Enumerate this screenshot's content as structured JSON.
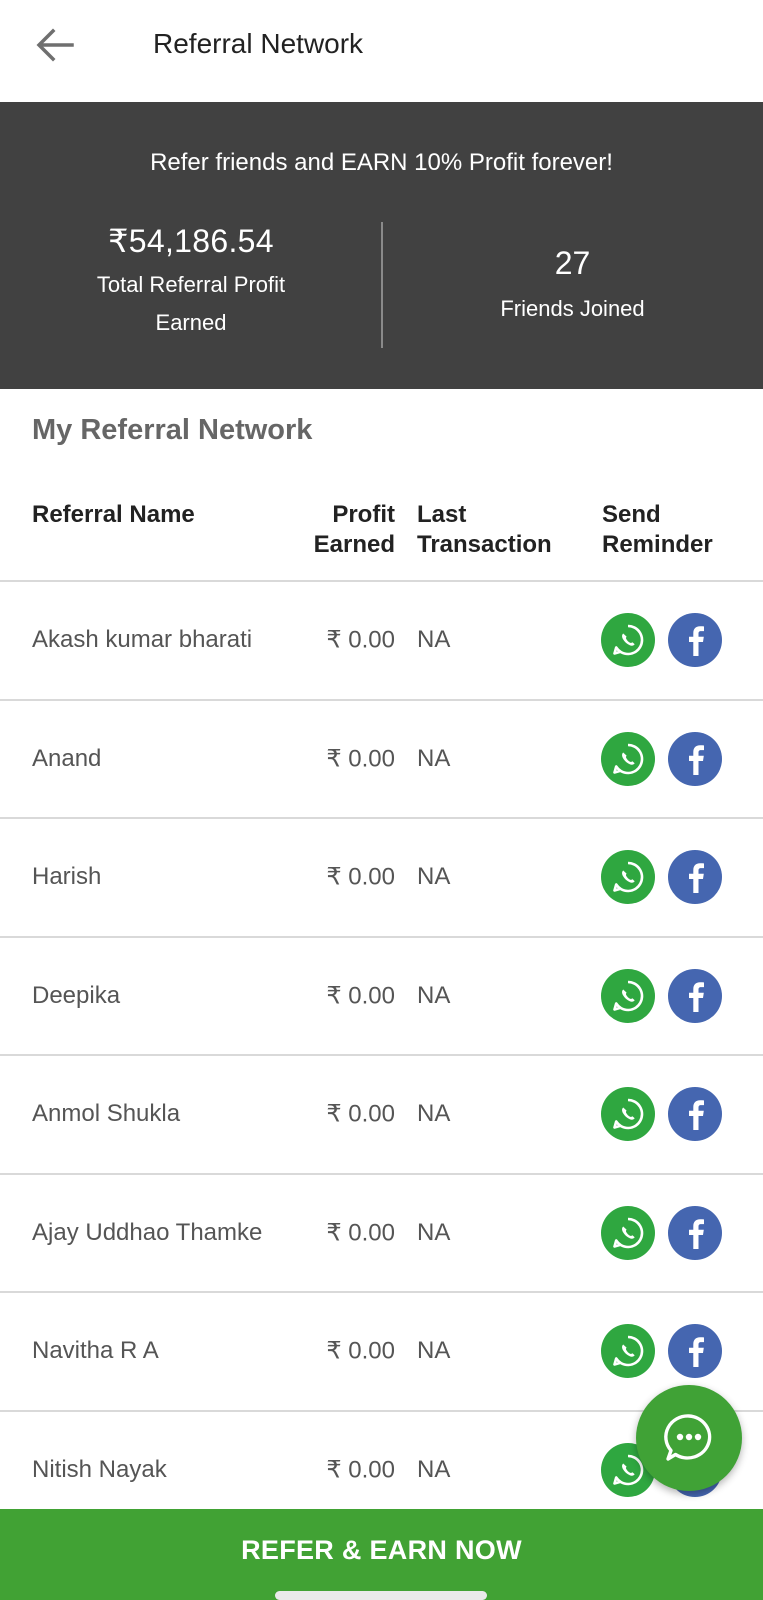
{
  "header": {
    "title": "Referral Network",
    "back_icon": "arrow-left-icon"
  },
  "banner": {
    "headline": "Refer friends and EARN 10% Profit forever!",
    "total_profit_amount": "₹54,186.54",
    "total_profit_label": "Total Referral Profit Earned",
    "friends_count": "27",
    "friends_label": "Friends Joined"
  },
  "section": {
    "title": "My Referral Network"
  },
  "table": {
    "columns": {
      "name": "Referral Name",
      "profit": "Profit Earned",
      "last": "Last Transaction",
      "send": "Send Reminder"
    },
    "rows": [
      {
        "name": "Akash kumar bharati",
        "profit": "₹ 0.00",
        "last": "NA"
      },
      {
        "name": "Anand",
        "profit": "₹ 0.00",
        "last": "NA"
      },
      {
        "name": "Harish",
        "profit": "₹ 0.00",
        "last": "NA"
      },
      {
        "name": "Deepika",
        "profit": "₹ 0.00",
        "last": "NA"
      },
      {
        "name": "Anmol Shukla",
        "profit": "₹ 0.00",
        "last": "NA"
      },
      {
        "name": "Ajay Uddhao Thamke",
        "profit": "₹ 0.00",
        "last": "NA"
      },
      {
        "name": "Navitha R A",
        "profit": "₹ 0.00",
        "last": "NA"
      },
      {
        "name": "Nitish Nayak",
        "profit": "₹ 0.00",
        "last": "NA"
      }
    ]
  },
  "cta": {
    "label": "REFER & EARN NOW"
  },
  "colors": {
    "banner_bg": "#414141",
    "whatsapp_green": "#2fa740",
    "facebook_blue": "#4566b0",
    "cta_green": "#41a234"
  }
}
